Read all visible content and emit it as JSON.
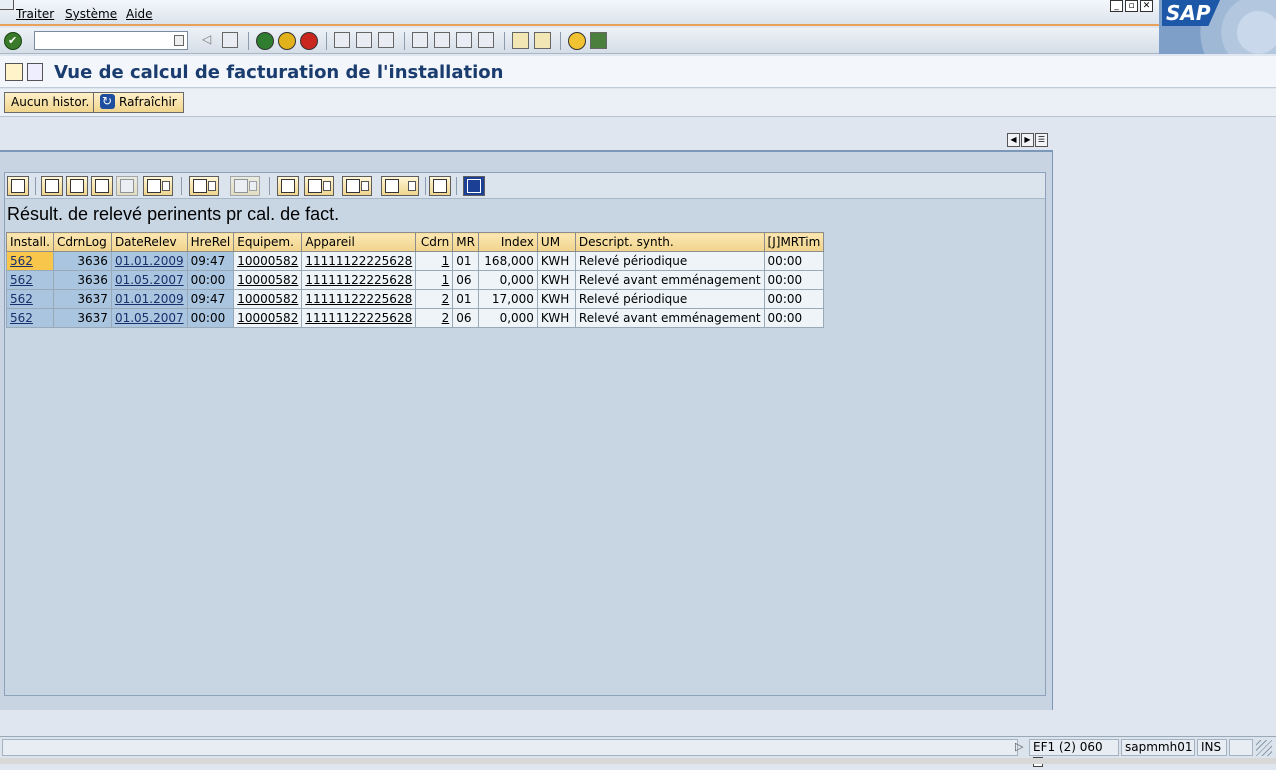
{
  "menu": {
    "items": [
      "Traiter",
      "Système",
      "Aide"
    ]
  },
  "toolbar": {
    "command_value": ""
  },
  "title": "Vue de calcul de facturation de l'installation",
  "app_toolbar": {
    "no_history_label": "Aucun histor.",
    "refresh_label": "Rafraîchir"
  },
  "grid": {
    "title": "Résult. de relevé perinents pr cal. de fact.",
    "columns": [
      "Install.",
      "CdrnLog",
      "DateRelev",
      "HreRel",
      "Equipem.",
      "Appareil",
      "Cdrn",
      "MR",
      "Index",
      "UM",
      "Descript. synth.",
      "[J]MRTim"
    ],
    "rows": [
      {
        "install": "562",
        "cdrnlog": "3636",
        "date": "01.01.2009",
        "hre": "09:47",
        "equip": "10000582",
        "appareil": "11111122225628",
        "cdrn": "1",
        "mr": "01",
        "index": "168,000",
        "um": "KWH",
        "desc": "Relevé périodique",
        "mrtim": "00:00"
      },
      {
        "install": "562",
        "cdrnlog": "3636",
        "date": "01.05.2007",
        "hre": "00:00",
        "equip": "10000582",
        "appareil": "11111122225628",
        "cdrn": "1",
        "mr": "06",
        "index": "0,000",
        "um": "KWH",
        "desc": "Relevé avant emménagement",
        "mrtim": "00:00"
      },
      {
        "install": "562",
        "cdrnlog": "3637",
        "date": "01.01.2009",
        "hre": "09:47",
        "equip": "10000582",
        "appareil": "11111122225628",
        "cdrn": "2",
        "mr": "01",
        "index": "17,000",
        "um": "KWH",
        "desc": "Relevé périodique",
        "mrtim": "00:00"
      },
      {
        "install": "562",
        "cdrnlog": "3637",
        "date": "01.05.2007",
        "hre": "00:00",
        "equip": "10000582",
        "appareil": "11111122225628",
        "cdrn": "2",
        "mr": "06",
        "index": "0,000",
        "um": "KWH",
        "desc": "Relevé avant emménagement",
        "mrtim": "00:00"
      }
    ]
  },
  "statusbar": {
    "system": "EF1 (2) 060",
    "server": "sapmmh01",
    "mode": "INS"
  },
  "brand": {
    "logo_text": "SAP",
    "accent": "#e8a15a",
    "title_color": "#1a3c6e",
    "selected_cell": "#f7c64a",
    "key_cell": "#a9c5e0"
  }
}
